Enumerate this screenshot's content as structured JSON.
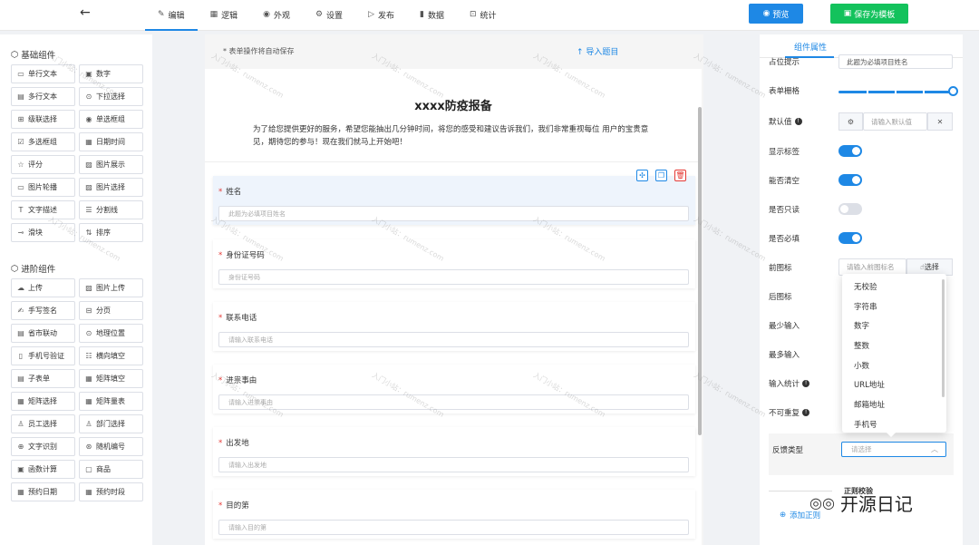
{
  "topbar": {
    "tabs": [
      {
        "icon": "pencil-icon",
        "glyph": "✎",
        "label": "编辑"
      },
      {
        "icon": "logic-icon",
        "glyph": "▦",
        "label": "逻辑"
      },
      {
        "icon": "eye-icon",
        "glyph": "◉",
        "label": "外观"
      },
      {
        "icon": "gear-icon",
        "glyph": "⚙",
        "label": "设置"
      },
      {
        "icon": "publish-icon",
        "glyph": "▷",
        "label": "发布"
      },
      {
        "icon": "bar-chart-icon",
        "glyph": "▮",
        "label": "数据"
      },
      {
        "icon": "stats-icon",
        "glyph": "⊡",
        "label": "统计"
      }
    ],
    "preview_label": "预览",
    "save_template_label": "保存为模板",
    "accent": "#1e88e5",
    "save_color": "#13c25c"
  },
  "left": {
    "basic_title": "基础组件",
    "basic": [
      {
        "icon": "textbox-icon",
        "glyph": "▭",
        "label": "单行文本"
      },
      {
        "icon": "number-icon",
        "glyph": "▣",
        "label": "数字"
      },
      {
        "icon": "textarea-icon",
        "glyph": "▤",
        "label": "多行文本"
      },
      {
        "icon": "dropdown-icon",
        "glyph": "⊙",
        "label": "下拉选择"
      },
      {
        "icon": "cascade-icon",
        "glyph": "⊞",
        "label": "级联选择"
      },
      {
        "icon": "radio-icon",
        "glyph": "◉",
        "label": "单选框组"
      },
      {
        "icon": "checkbox-icon",
        "glyph": "☑",
        "label": "多选框组"
      },
      {
        "icon": "datetime-icon",
        "glyph": "▦",
        "label": "日期时间"
      },
      {
        "icon": "star-icon",
        "glyph": "☆",
        "label": "评分"
      },
      {
        "icon": "image-icon",
        "glyph": "▨",
        "label": "图片展示"
      },
      {
        "icon": "carousel-icon",
        "glyph": "▭",
        "label": "图片轮播"
      },
      {
        "icon": "image-select-icon",
        "glyph": "▨",
        "label": "图片选择"
      },
      {
        "icon": "text-icon",
        "glyph": "T",
        "label": "文字描述"
      },
      {
        "icon": "divider-icon",
        "glyph": "☰",
        "label": "分割线"
      },
      {
        "icon": "slider-icon",
        "glyph": "⊸",
        "label": "滑块"
      },
      {
        "icon": "sort-icon",
        "glyph": "⇅",
        "label": "排序"
      }
    ],
    "advanced_title": "进阶组件",
    "advanced": [
      {
        "icon": "upload-icon",
        "glyph": "☁",
        "label": "上传"
      },
      {
        "icon": "image-upload-icon",
        "glyph": "▨",
        "label": "图片上传"
      },
      {
        "icon": "signature-icon",
        "glyph": "✍",
        "label": "手写签名"
      },
      {
        "icon": "pagination-icon",
        "glyph": "⊟",
        "label": "分页"
      },
      {
        "icon": "province-icon",
        "glyph": "▤",
        "label": "省市联动"
      },
      {
        "icon": "location-icon",
        "glyph": "⊙",
        "label": "地理位置"
      },
      {
        "icon": "phone-icon",
        "glyph": "▯",
        "label": "手机号验证"
      },
      {
        "icon": "horizontal-fill-icon",
        "glyph": "☷",
        "label": "横向填空"
      },
      {
        "icon": "subform-icon",
        "glyph": "▤",
        "label": "子表单"
      },
      {
        "icon": "matrix-fill-icon",
        "glyph": "▦",
        "label": "矩阵填空"
      },
      {
        "icon": "matrix-select-icon",
        "glyph": "▦",
        "label": "矩阵选择"
      },
      {
        "icon": "matrix-scale-icon",
        "glyph": "▦",
        "label": "矩阵量表"
      },
      {
        "icon": "employee-icon",
        "glyph": "♙",
        "label": "员工选择"
      },
      {
        "icon": "department-icon",
        "glyph": "♙",
        "label": "部门选择"
      },
      {
        "icon": "ocr-icon",
        "glyph": "⊕",
        "label": "文字识别"
      },
      {
        "icon": "random-number-icon",
        "glyph": "⊛",
        "label": "随机编号"
      },
      {
        "icon": "function-icon",
        "glyph": "▣",
        "label": "函数计算"
      },
      {
        "icon": "goods-icon",
        "glyph": "▢",
        "label": "商品"
      },
      {
        "icon": "booking-date-icon",
        "glyph": "▦",
        "label": "预约日期"
      },
      {
        "icon": "booking-time-icon",
        "glyph": "▦",
        "label": "预约时段"
      }
    ]
  },
  "center": {
    "autosave": "* 表单操作将自动保存",
    "import_label": "导入题目",
    "form_title": "xxxx防疫报备",
    "form_desc": "为了给您提供更好的服务，希望您能抽出几分钟时间，将您的感受和建议告诉我们，我们非常重视每位 用户的宝贵意见，期待您的参与！现在我们就马上开始吧！",
    "fields": [
      {
        "label": "姓名",
        "placeholder": "此题为必填项目姓名"
      },
      {
        "label": "身份证号码",
        "placeholder": "身份证号码"
      },
      {
        "label": "联系电话",
        "placeholder": "请输入联系电话"
      },
      {
        "label": "进祟事由",
        "placeholder": "请输入进祟事由"
      },
      {
        "label": "出发地",
        "placeholder": "请输入出发地"
      },
      {
        "label": "目的第",
        "placeholder": "请输入目的第"
      }
    ]
  },
  "right": {
    "tab": "组件属性",
    "placeholder_label": "占位提示",
    "placeholder_value": "此题为必填项目姓名",
    "grid_label": "表单栅格",
    "default_label": "默认值",
    "default_placeholder": "请输入默认值",
    "show_label": "显示标签",
    "clearable": "能否清空",
    "readonly": "是否只读",
    "required": "是否必填",
    "prefix_icon": "前图标",
    "prefix_placeholder": "请输入前图标名",
    "select_label": "选择",
    "suffix_icon": "后图标",
    "min_input": "最少输入",
    "max_input": "最多输入",
    "input_stat": "输入统计",
    "no_repeat": "不可重复",
    "feedback_type": "反馈类型",
    "feedback_placeholder": "请选择",
    "regex": "正则校验",
    "add_rule": "添加正则",
    "dropdown": [
      "无校验",
      "字符串",
      "数字",
      "整数",
      "小数",
      "URL地址",
      "邮箱地址",
      "手机号"
    ]
  },
  "watermark": "入门小站：rumenz.com",
  "brand": "开源日记"
}
